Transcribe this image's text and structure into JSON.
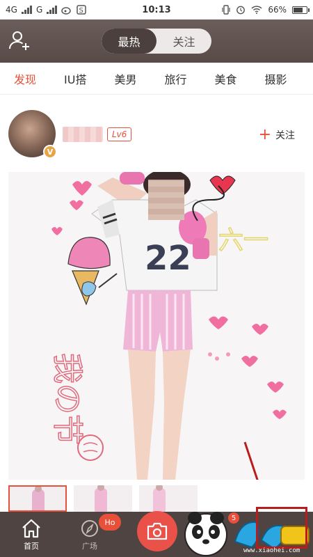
{
  "status_bar": {
    "network_left": "4G",
    "network_right": "G",
    "time": "10:13",
    "battery": "66%",
    "battery_level": 0.66
  },
  "header": {
    "segments": [
      {
        "label": "最热",
        "active": true
      },
      {
        "label": "关注",
        "active": false
      }
    ]
  },
  "tabs": [
    {
      "label": "发现",
      "active": true
    },
    {
      "label": "IU搭",
      "active": false
    },
    {
      "label": "美男",
      "active": false
    },
    {
      "label": "旅行",
      "active": false
    },
    {
      "label": "美食",
      "active": false
    },
    {
      "label": "摄影",
      "active": false
    }
  ],
  "post": {
    "avatar_badge": "V",
    "level": "Lv6",
    "follow_label": "关注",
    "photo_doodles": {
      "number": "22",
      "handwriting": "我の节",
      "handwriting_right": "六一"
    }
  },
  "bottom_nav": {
    "home_label": "首页",
    "square_label": "广场",
    "square_badge": "Ho",
    "message_badge": "5"
  },
  "watermark": {
    "url": "www.xiaohei.com"
  },
  "colors": {
    "accent": "#e8503a",
    "header_bg": "#584b47",
    "nav_bg": "#4f4441"
  }
}
